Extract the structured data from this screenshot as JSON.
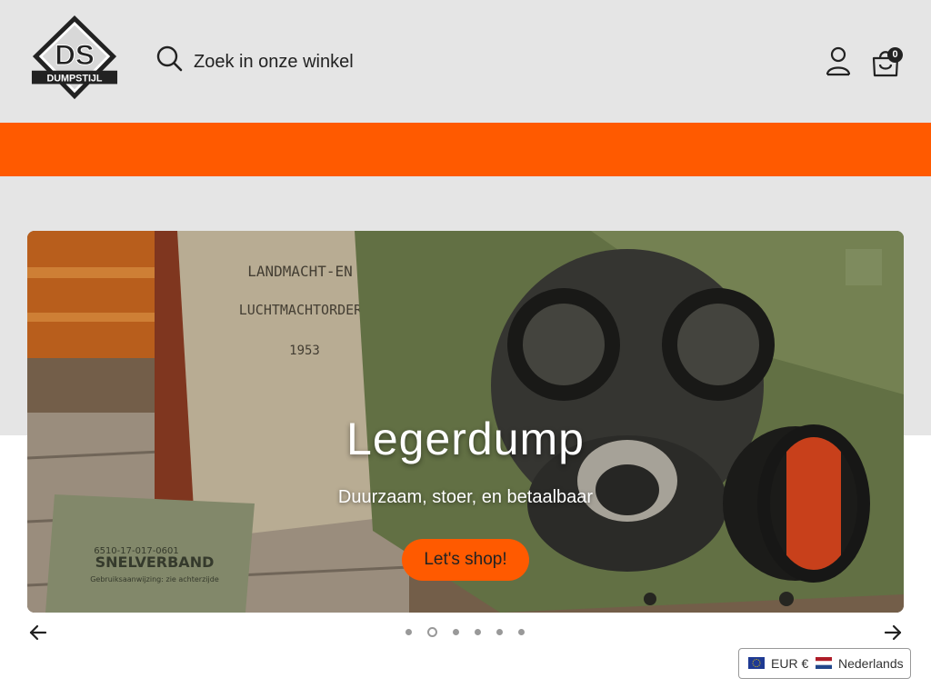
{
  "header": {
    "logo_alt": "DS Dumpstijl",
    "logo_text": "DUMPSTIJL",
    "search_placeholder": "Zoek in onze winkel",
    "cart_count": "0",
    "colors": {
      "background": "#e5e5e5",
      "accent": "#ff5a00"
    }
  },
  "hero": {
    "slide_title": "Legerdump",
    "slide_subtitle": "Duurzaam, stoer, en betaalbaar",
    "cta_label": "Let's shop!",
    "slide_count": 6,
    "active_slide": 2,
    "book_lines": [
      "LANDMACHT-EN",
      "LUCHTMACHTORDERS",
      "1953"
    ],
    "bandage_lines": [
      "6510-17-017-0601",
      "SNELVERBAND",
      "Gebruiksaanwijzing: zie achterzijde"
    ]
  },
  "icons": {
    "search": "search-icon",
    "account": "user-icon",
    "cart": "shopping-bag-icon",
    "prev": "arrow-left-icon",
    "next": "arrow-right-icon"
  },
  "locale": {
    "currency": "EUR €",
    "language": "Nederlands"
  }
}
